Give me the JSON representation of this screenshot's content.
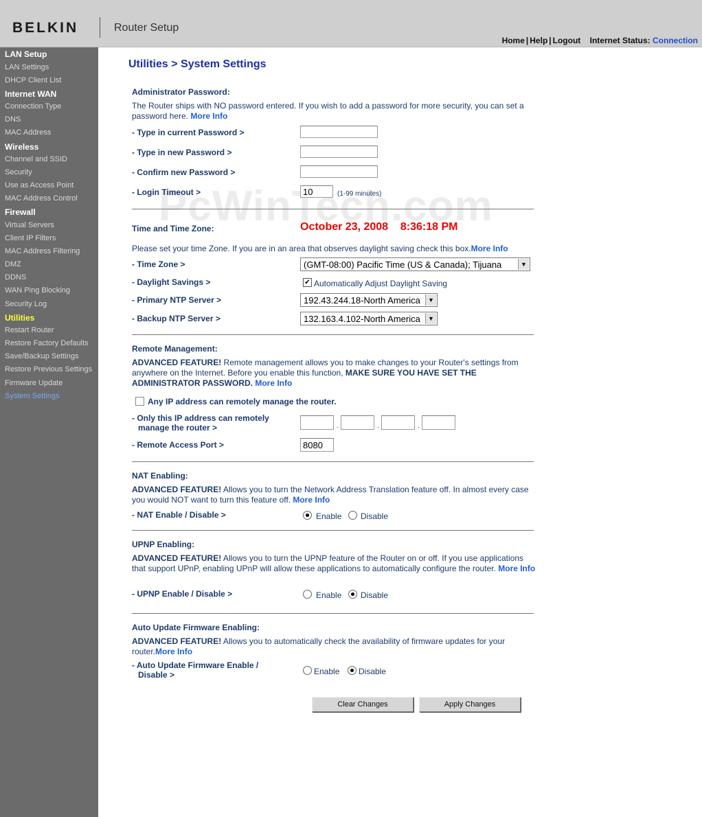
{
  "header": {
    "brand": "BELKIN",
    "product": "Router Setup",
    "links": [
      "Home",
      "Help",
      "Logout"
    ],
    "status_label": "Internet Status:",
    "status_value": "Connection"
  },
  "sidebar": [
    {
      "label": "LAN Setup",
      "type": "head"
    },
    {
      "label": "LAN Settings",
      "type": "item"
    },
    {
      "label": "DHCP Client List",
      "type": "item"
    },
    {
      "label": "Internet WAN",
      "type": "head"
    },
    {
      "label": "Connection Type",
      "type": "item"
    },
    {
      "label": "DNS",
      "type": "item"
    },
    {
      "label": "MAC Address",
      "type": "item"
    },
    {
      "label": "Wireless",
      "type": "head"
    },
    {
      "label": "Channel and SSID",
      "type": "item"
    },
    {
      "label": "Security",
      "type": "item"
    },
    {
      "label": "Use as Access Point",
      "type": "item"
    },
    {
      "label": "MAC Address Control",
      "type": "item"
    },
    {
      "label": "Firewall",
      "type": "head"
    },
    {
      "label": "Virtual Servers",
      "type": "item"
    },
    {
      "label": "Client IP Filters",
      "type": "item"
    },
    {
      "label": "MAC Address Filtering",
      "type": "item"
    },
    {
      "label": "DMZ",
      "type": "item"
    },
    {
      "label": "DDNS",
      "type": "item"
    },
    {
      "label": "WAN Ping Blocking",
      "type": "item"
    },
    {
      "label": "Security Log",
      "type": "item"
    },
    {
      "label": "Utilities",
      "type": "head-active"
    },
    {
      "label": "Restart Router",
      "type": "item"
    },
    {
      "label": "Restore Factory Defaults",
      "type": "item"
    },
    {
      "label": "Save/Backup Settings",
      "type": "item"
    },
    {
      "label": "Restore Previous Settings",
      "type": "item"
    },
    {
      "label": "Firmware Update",
      "type": "item"
    },
    {
      "label": "System Settings",
      "type": "current"
    }
  ],
  "page": {
    "title": "Utilities > System Settings",
    "watermark": "PcWinTech.com"
  },
  "admin": {
    "heading": "Administrator Password:",
    "desc": "The Router ships with NO password entered. If you wish to add a password for more security, you can set a password here.",
    "more_info": "More Info",
    "current_label": "- Type in current Password >",
    "new_label": "- Type in new Password >",
    "confirm_label": "- Confirm new Password >",
    "timeout_label": "- Login Timeout >",
    "timeout_value": "10",
    "timeout_hint": "(1-99 minutes)"
  },
  "time": {
    "heading": "Time and Time Zone:",
    "datetime": "October 23, 2008    8:36:18 PM",
    "desc": "Please set your time Zone. If you are in an area that observes daylight saving check this box.",
    "more_info": "More Info",
    "zone_label": "- Time Zone >",
    "zone_value": "(GMT-08:00) Pacific Time (US & Canada); Tijuana",
    "dst_label": "- Daylight Savings >",
    "dst_option": "Automatically Adjust Daylight Saving",
    "dst_checked": "✔",
    "primary_label": "- Primary NTP Server >",
    "primary_value": "192.43.244.18-North America",
    "backup_label": "- Backup NTP Server >",
    "backup_value": "132.163.4.102-North America"
  },
  "remote": {
    "heading": "Remote Management:",
    "desc_bold1": "ADVANCED FEATURE!",
    "desc1": " Remote management allows you to make changes to your Router's settings from anywhere on the Internet. Before you enable this function, ",
    "desc_bold2": "MAKE SURE YOU HAVE SET THE ADMINISTRATOR PASSWORD.",
    "more_info": "More Info",
    "any_ip_label": "Any IP address can remotely manage the router.",
    "only_ip_label_1": "- Only this IP address can remotely",
    "only_ip_label_2": "manage the router >",
    "port_label": "- Remote Access Port >",
    "port_value": "8080"
  },
  "nat": {
    "heading": "NAT Enabling:",
    "desc_bold": "ADVANCED FEATURE!",
    "desc": " Allows you to turn the Network Address Translation feature off. In almost every case you would NOT want to turn this feature off.",
    "more_info": "More Info",
    "toggle_label": "- NAT Enable / Disable >",
    "enable": "Enable",
    "disable": "Disable",
    "selected": "Enable"
  },
  "upnp": {
    "heading": "UPNP Enabling:",
    "desc_bold": "ADVANCED FEATURE!",
    "desc": " Allows you to turn the UPNP feature of the Router on or off. If you use applications that support UPnP, enabling UPnP will allow these applications to automatically configure the router.",
    "more_info": "More Info",
    "toggle_label": "- UPNP Enable / Disable >",
    "enable": "Enable",
    "disable": "Disable",
    "selected": "Disable"
  },
  "autoupdate": {
    "heading": "Auto Update Firmware Enabling:",
    "desc_bold": "ADVANCED FEATURE!",
    "desc": " Allows you to automatically check the availability of firmware updates for your router.",
    "more_info": "More Info",
    "toggle_label_1": "- Auto Update Firmware Enable /",
    "toggle_label_2": "Disable >",
    "enable": "Enable",
    "disable": "Disable",
    "selected": "Disable"
  },
  "buttons": {
    "clear": "Clear Changes",
    "apply": "Apply Changes"
  }
}
